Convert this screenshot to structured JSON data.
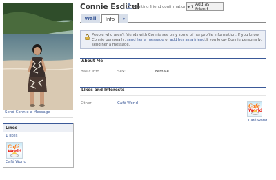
{
  "profile": {
    "name": "Connie Esdicul",
    "friend_status": "Awaiting friend confirmation",
    "add_friend_label": "Add as Friend"
  },
  "tabs": [
    {
      "label": "Wall",
      "active": false
    },
    {
      "label": "Info",
      "active": true
    },
    {
      "label": "»",
      "active": false
    }
  ],
  "privacy": {
    "text_1": "People who aren't friends with Connie see only some of her profile information. If you know Connie personally, ",
    "link_1": "send her a message",
    "text_2": " or ",
    "link_2": "add her as a friend",
    "text_3": ".If you know Connie personally, send her a message."
  },
  "left": {
    "send_message": "Send Connie a Message",
    "likes_title": "Likes",
    "likes_count": "1 likes",
    "liked_app": "Café World"
  },
  "about": {
    "title": "About Me",
    "basic_info_label": "Basic Info",
    "sex_label": "Sex:",
    "sex_value": "Female"
  },
  "interests": {
    "title": "Likes and Interests",
    "other_label": "Other",
    "other_value": "Café World",
    "app_caption": "Café World"
  },
  "logo_text": {
    "top": "Café",
    "bottom": "World"
  },
  "colors": {
    "link": "#3b5998",
    "tab_bg": "#d8dfea",
    "notice_bg": "#eceff6"
  }
}
